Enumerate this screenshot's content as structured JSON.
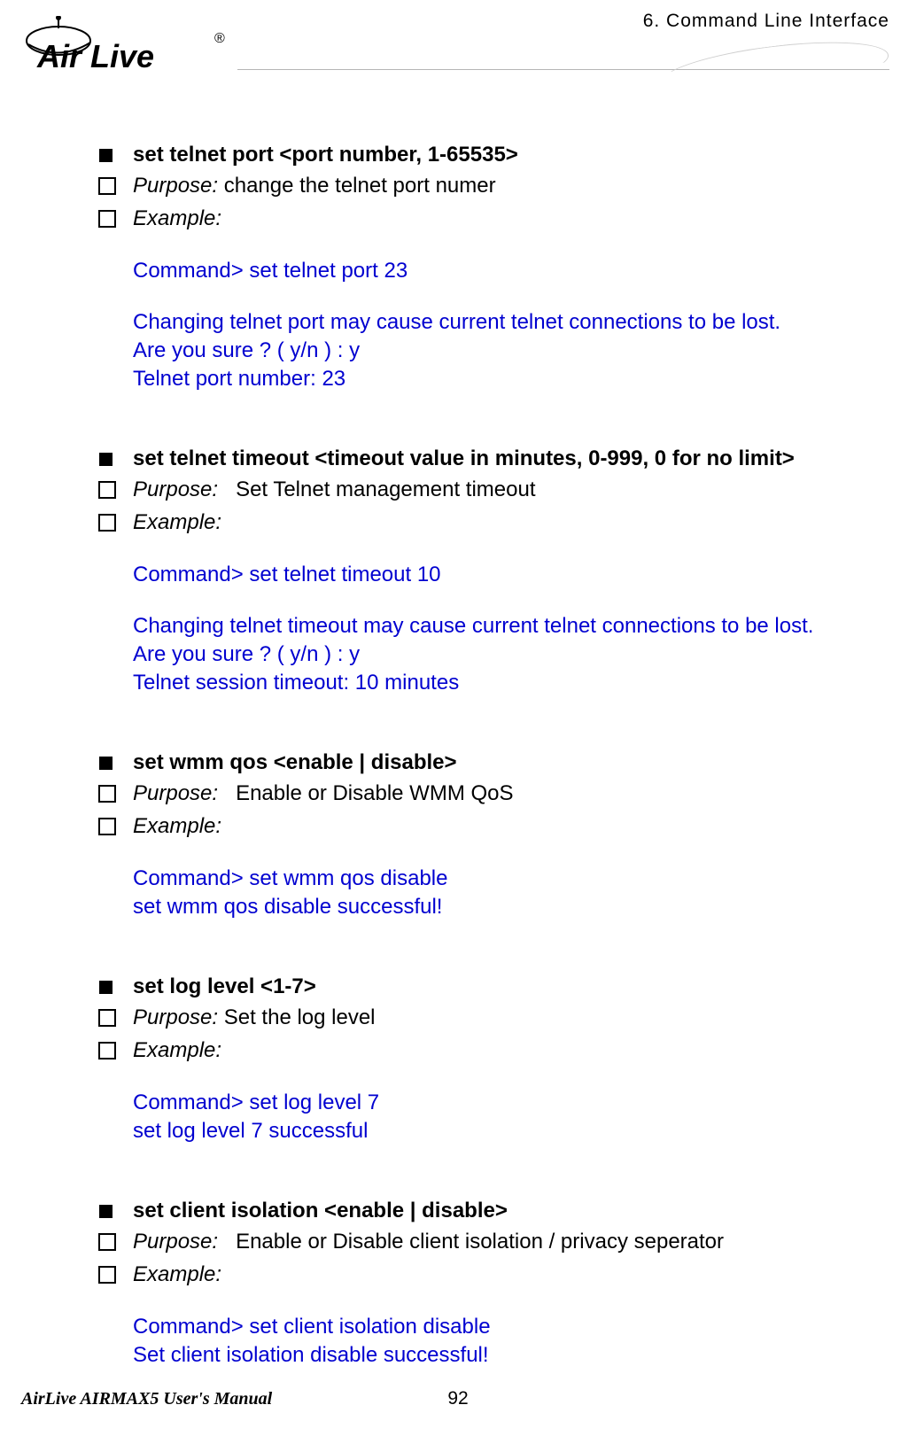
{
  "header": {
    "breadcrumb": "6.  Command Line Interface",
    "logo_text_main": "Air Live",
    "logo_text_r": "®"
  },
  "sections": [
    {
      "title": "set telnet port <port number, 1-65535>",
      "purpose_label": "Purpose:",
      "purpose_text": " change the telnet port numer",
      "example_label": "Example:",
      "example_lines_1": [
        "Command> set telnet port 23"
      ],
      "example_lines_2": [
        "Changing telnet port may cause current telnet connections to be lost.",
        "Are you sure ? ( y/n ) : y",
        "Telnet port number: 23"
      ]
    },
    {
      "title": "set telnet timeout <timeout value in minutes, 0-999, 0 for no limit>",
      "purpose_label": "Purpose:",
      "purpose_text": "   Set Telnet management timeout",
      "example_label": "Example:",
      "example_lines_1": [
        "Command> set telnet timeout 10"
      ],
      "example_lines_2": [
        "Changing telnet timeout may cause current telnet connections to be lost.",
        "Are you sure ? ( y/n ) : y",
        "Telnet session timeout: 10 minutes"
      ]
    },
    {
      "title": "set wmm qos <enable | disable>",
      "purpose_label": "Purpose:",
      "purpose_text": "   Enable or Disable WMM QoS",
      "example_label": "Example:",
      "example_lines_1": [
        "Command> set wmm qos disable",
        "set wmm qos disable successful!"
      ],
      "example_lines_2": []
    },
    {
      "title": "set log level <1-7>",
      "purpose_label": "Purpose:",
      "purpose_text": " Set the log level",
      "example_label": "Example:",
      "example_lines_1": [
        "Command> set log level 7",
        "set log level 7 successful"
      ],
      "example_lines_2": []
    },
    {
      "title": "set client isolation <enable | disable>",
      "purpose_label": "Purpose:",
      "purpose_text": "   Enable or Disable client isolation / privacy seperator",
      "example_label": "Example:",
      "example_lines_1": [
        "Command> set client isolation disable",
        "Set client isolation disable successful!"
      ],
      "example_lines_2": []
    }
  ],
  "footer": {
    "manual_title": "AirLive AIRMAX5 User's Manual",
    "page_number": "92"
  }
}
